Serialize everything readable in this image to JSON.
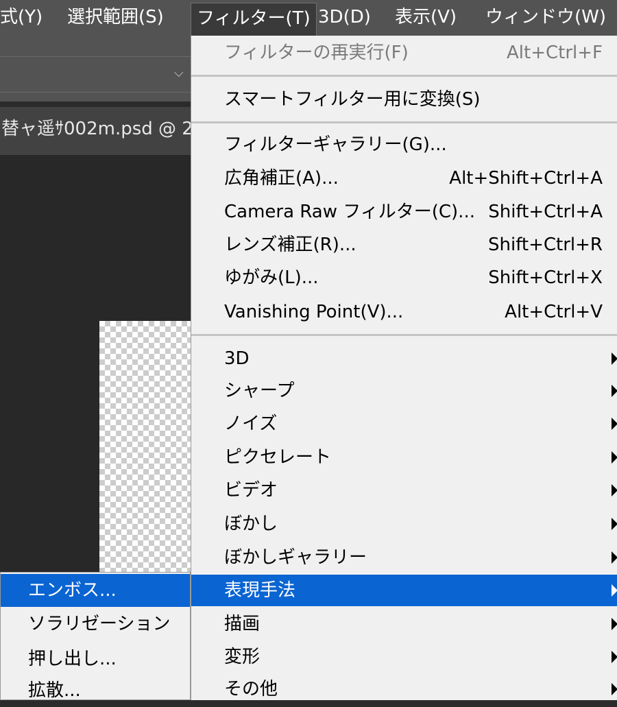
{
  "menubar": {
    "items": [
      "式(Y)",
      "選択範囲(S)",
      "フィルター(T)",
      "3D(D)",
      "表示(V)",
      "ウィンドウ(W)"
    ]
  },
  "document": {
    "tab_title": "替ャ遥ｻ002m.psd @ 2"
  },
  "filter_menu": {
    "last_filter": {
      "label": "フィルターの再実行(F)",
      "shortcut": "Alt+Ctrl+F"
    },
    "smart_filter": {
      "label": "スマートフィルター用に変換(S)"
    },
    "gallery": {
      "label": "フィルターギャラリー(G)..."
    },
    "adaptive_wide_angle": {
      "label": "広角補正(A)...",
      "shortcut": "Alt+Shift+Ctrl+A"
    },
    "camera_raw": {
      "label": "Camera Raw フィルター(C)...",
      "shortcut": "Shift+Ctrl+A"
    },
    "lens_correction": {
      "label": "レンズ補正(R)...",
      "shortcut": "Shift+Ctrl+R"
    },
    "liquify": {
      "label": "ゆがみ(L)...",
      "shortcut": "Shift+Ctrl+X"
    },
    "vanishing_point": {
      "label": "Vanishing Point(V)...",
      "shortcut": "Alt+Ctrl+V"
    },
    "groups": [
      "3D",
      "シャープ",
      "ノイズ",
      "ピクセレート",
      "ビデオ",
      "ぼかし",
      "ぼかしギャラリー",
      "表現手法",
      "描画",
      "変形",
      "その他"
    ]
  },
  "stylize_submenu": {
    "items": [
      "エンボス...",
      "ソラリゼーション",
      "押し出し...",
      "拡散..."
    ]
  },
  "colors": {
    "highlight": "#0a64d2",
    "menu_bg": "#f0f0f0",
    "menubar_bg": "#535353"
  }
}
